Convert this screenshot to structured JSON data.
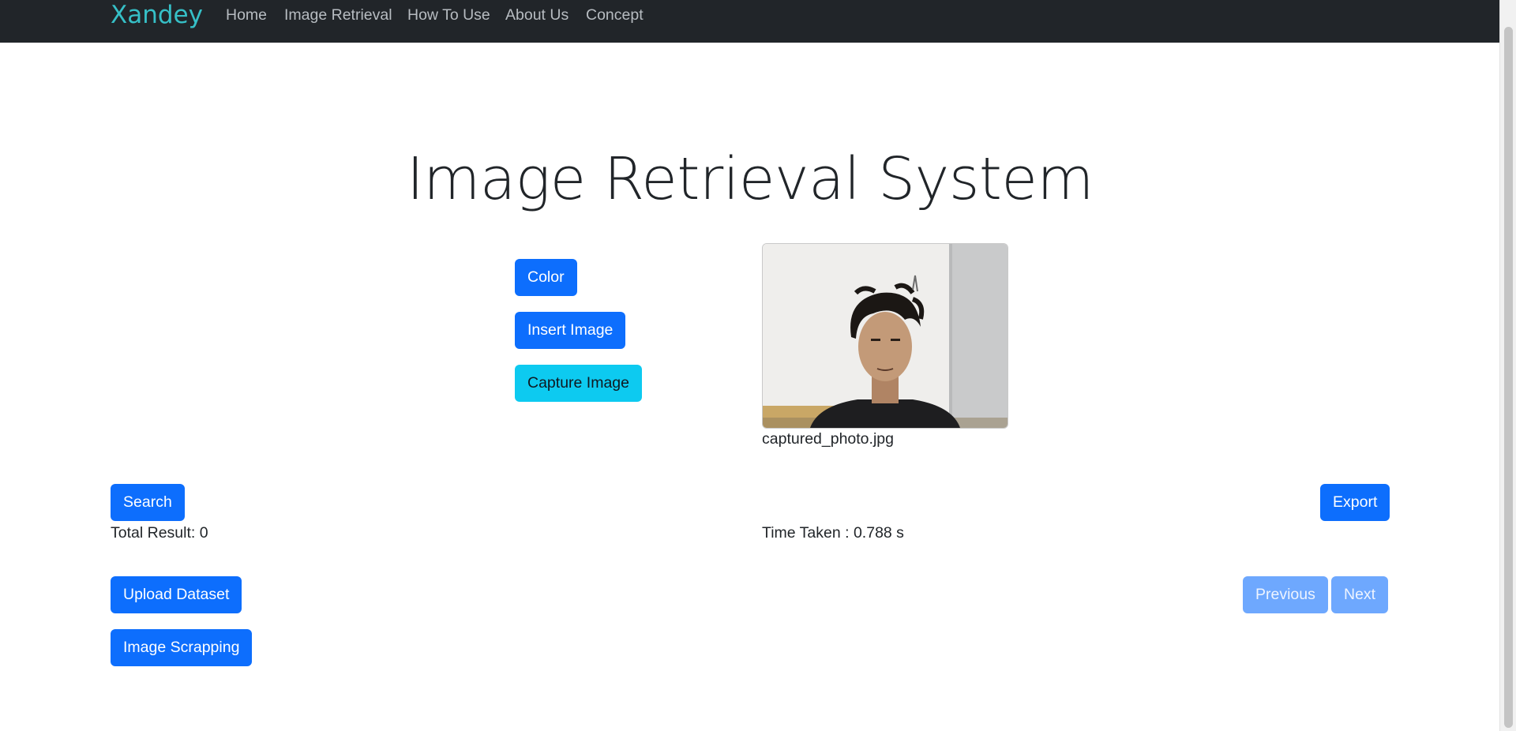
{
  "navbar": {
    "brand": "Xandey",
    "links": [
      "Home",
      "Image Retrieval",
      "How To Use",
      "About Us",
      "Concept"
    ]
  },
  "page": {
    "title": "Image Retrieval System"
  },
  "options": {
    "color_label": "Color",
    "insert_label": "Insert Image",
    "capture_label": "Capture Image"
  },
  "preview": {
    "filename": "captured_photo.jpg"
  },
  "actions": {
    "search_label": "Search",
    "export_label": "Export",
    "total_result": "Total Result: 0",
    "time_taken": "Time Taken : 0.788 s",
    "upload_label": "Upload Dataset",
    "scrapping_label": "Image Scrapping",
    "previous_label": "Previous",
    "next_label": "Next"
  },
  "colors": {
    "primary": "#0d6efd",
    "info": "#0dcaf0",
    "navbar_bg": "#212529",
    "brand": "#36c0c7"
  }
}
